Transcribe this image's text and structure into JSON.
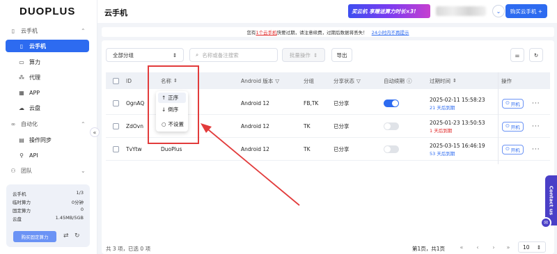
{
  "brand": {
    "logo": "DUOPLUS"
  },
  "sidebar": {
    "groups": [
      {
        "label": "云手机",
        "icon": "phone-icon"
      },
      {
        "label": "自动化",
        "icon": "link-icon"
      },
      {
        "label": "团队",
        "icon": "team-icon"
      }
    ],
    "items": [
      {
        "label": "云手机",
        "icon": "phone-icon",
        "active": true
      },
      {
        "label": "算力",
        "icon": "monitor-icon"
      },
      {
        "label": "代理",
        "icon": "proxy-icon"
      },
      {
        "label": "APP",
        "icon": "apps-icon"
      },
      {
        "label": "云盘",
        "icon": "cloud-icon"
      },
      {
        "label": "操作同步",
        "icon": "sync-icon"
      },
      {
        "label": "API",
        "icon": "api-icon"
      }
    ],
    "quota": {
      "rows": [
        {
          "label": "云手机",
          "value": "1/3"
        },
        {
          "label": "临时算力",
          "value": "0分钟"
        },
        {
          "label": "固定算力",
          "value": "0"
        },
        {
          "label": "云盘",
          "value": "1.45MB/5GB"
        }
      ],
      "buy_label": "购买固定算力"
    }
  },
  "header": {
    "title": "云手机",
    "banner_text": "买云机 享赠送算力时长×3!",
    "buy_label": "购买云手机 +"
  },
  "notice": {
    "prefix": "您有",
    "link": "1个云手机",
    "middle": "快要过期，请注意续费，过期后数据将丢失！",
    "action": "24小时内不再提示"
  },
  "toolbar": {
    "group_select": "全部分组",
    "search_placeholder": "名称或备注搜索",
    "bulk_label": "批量操作",
    "export_label": "导出"
  },
  "table": {
    "headers": {
      "id": "ID",
      "name": "名称",
      "android": "Android 版本",
      "group": "分组",
      "share": "分享状态",
      "renew": "自动续期",
      "expire": "过期时间",
      "ops": "操作"
    },
    "rows": [
      {
        "id": "OgnAQ",
        "name": "",
        "android": "Android 12",
        "group": "FB,TK",
        "share": "已分享",
        "renew": true,
        "expire": "2025-02-11 15:58:23",
        "remain": "21 天后到期",
        "remain_color": "#2d6bf0",
        "power": "开机"
      },
      {
        "id": "ZdOvn",
        "name": "",
        "android": "Android 12",
        "group": "TK",
        "share": "已分享",
        "renew": false,
        "expire": "2025-01-23 13:50:53",
        "remain": "1 天后到期",
        "remain_color": "#e02424",
        "power": "开机"
      },
      {
        "id": "TvYtw",
        "name": "DuoPlus",
        "android": "Android 12",
        "group": "TK",
        "share": "已分享",
        "renew": false,
        "expire": "2025-03-15 16:46:19",
        "remain": "53 天后到期",
        "remain_color": "#2d6bf0",
        "power": "开机"
      }
    ]
  },
  "sort_popup": {
    "options": [
      "正序",
      "倒序",
      "不设置"
    ]
  },
  "footer": {
    "summary": "共 3 项，已选 0 项",
    "page_info": "第1页，共1页",
    "page_size": "10"
  },
  "contact": {
    "label": "Contact us"
  },
  "colors": {
    "accent": "#2d6bf0",
    "highlight": "#e23b3b",
    "danger": "#e02424"
  }
}
